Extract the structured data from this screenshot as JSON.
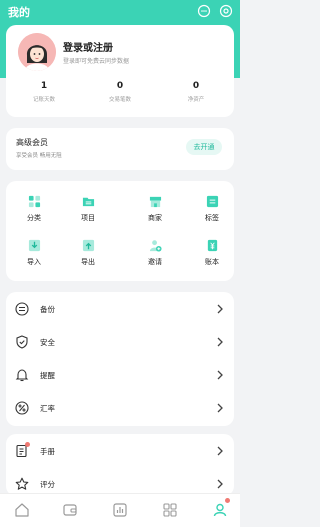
{
  "header": {
    "title": "我的"
  },
  "profile": {
    "login_title": "登录或注册",
    "login_sub": "登录即可免费云同步数据",
    "stats": [
      {
        "value": "1",
        "label": "记账天数"
      },
      {
        "value": "0",
        "label": "交易笔数"
      },
      {
        "value": "0",
        "label": "净资产"
      }
    ]
  },
  "vip": {
    "title": "高级会员",
    "subtitle": "享受会员 畅用无阻",
    "button": "去开通"
  },
  "grid": {
    "items": [
      {
        "label": "分类",
        "icon": "category-icon"
      },
      {
        "label": "项目",
        "icon": "folder-icon"
      },
      {
        "label": "商家",
        "icon": "store-icon"
      },
      {
        "label": "标签",
        "icon": "tag-icon"
      },
      {
        "label": "导入",
        "icon": "import-icon"
      },
      {
        "label": "导出",
        "icon": "export-icon"
      },
      {
        "label": "邀请",
        "icon": "invite-icon"
      },
      {
        "label": "账本",
        "icon": "ledger-icon"
      }
    ]
  },
  "list1": {
    "items": [
      {
        "label": "备份",
        "icon": "backup-icon"
      },
      {
        "label": "安全",
        "icon": "shield-icon"
      },
      {
        "label": "提醒",
        "icon": "bell-icon"
      },
      {
        "label": "汇率",
        "icon": "exchange-rate-icon"
      }
    ]
  },
  "list2": {
    "items": [
      {
        "label": "手册",
        "icon": "manual-icon"
      },
      {
        "label": "评分",
        "icon": "star-icon"
      }
    ]
  },
  "tabbar": {
    "tabs": [
      {
        "name": "home-tab",
        "icon": "home-icon"
      },
      {
        "name": "wallet-tab",
        "icon": "wallet-icon"
      },
      {
        "name": "stats-tab",
        "icon": "chart-icon"
      },
      {
        "name": "apps-tab",
        "icon": "apps-icon"
      },
      {
        "name": "me-tab",
        "icon": "user-icon"
      }
    ]
  },
  "colors": {
    "accent": "#3bd3b5",
    "badge": "#f07a73"
  }
}
